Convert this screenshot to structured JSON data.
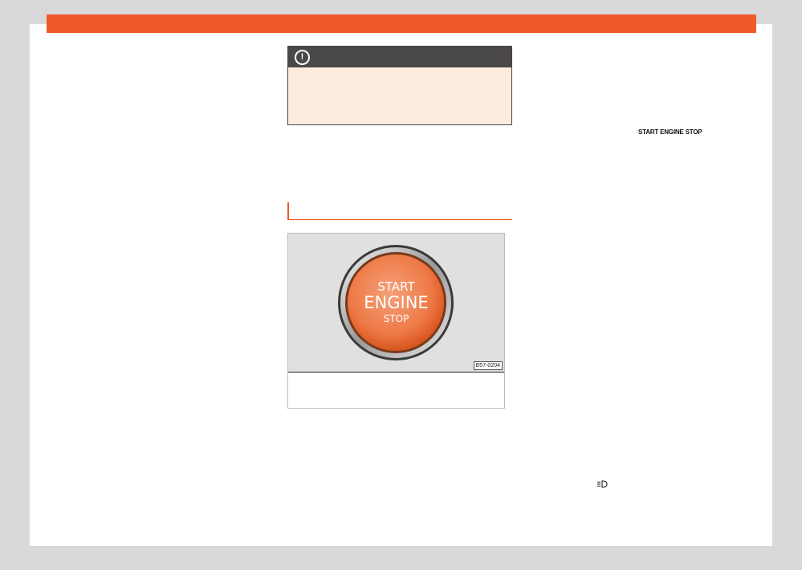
{
  "header": {
    "accent_color": "#f05a28"
  },
  "notice": {
    "icon": "exclamation-circle-icon",
    "symbol": "!",
    "background": "#fdebdd",
    "header_color": "#4a4747"
  },
  "figure": {
    "button_text": {
      "line1": "START",
      "line2": "ENGINE",
      "line3": "STOP"
    },
    "image_code": "B57-0204"
  },
  "body_text": {
    "inline_key": "START ENGINE STOP"
  },
  "icons": {
    "light": "headlight-icon"
  }
}
